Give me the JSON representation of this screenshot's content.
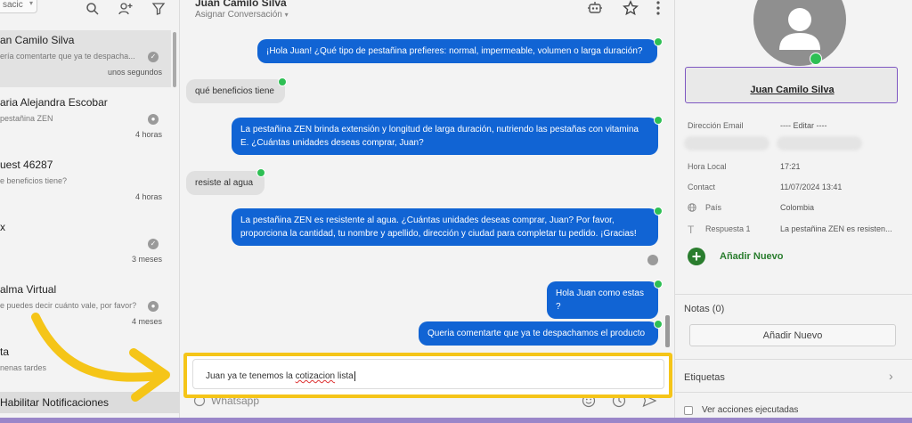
{
  "left_panel": {
    "filter_value": "sacic",
    "conversations": [
      {
        "name": "an Camilo Silva",
        "snippet": "ería comentarte que ya te despacha...",
        "time": "unos segundos",
        "active": true
      },
      {
        "name": "aria Alejandra Escobar",
        "snippet": "pestañina ZEN",
        "time": "4 horas",
        "active": false
      },
      {
        "name": "uest 46287",
        "snippet": "e beneficios tiene?",
        "time": "4 horas",
        "active": false
      },
      {
        "name": "x",
        "snippet": "",
        "time": "3 meses",
        "active": false
      },
      {
        "name": "alma Virtual",
        "snippet": "e puedes decir cuánto vale, por favor?",
        "time": "4 meses",
        "active": false
      },
      {
        "name": "ta",
        "snippet": "nenas tardes",
        "time": "",
        "active": false
      }
    ],
    "notifications_label": "Habilitar Notificaciones"
  },
  "chat": {
    "contact_name": "Juan Camilo Silva",
    "assign_label": "Asignar Conversación",
    "messages": [
      {
        "dir": "out",
        "text": "¡Hola Juan! ¿Qué tipo de pestañina prefieres: normal, impermeable, volumen o larga duración?"
      },
      {
        "dir": "in",
        "text": "qué beneficios tiene"
      },
      {
        "dir": "out",
        "text": "La pestañina ZEN brinda extensión y longitud de larga duración, nutriendo las pestañas con vitamina E. ¿Cuántas unidades deseas comprar, Juan?"
      },
      {
        "dir": "in",
        "text": "resiste al agua"
      },
      {
        "dir": "out",
        "text": "La pestañina ZEN es resistente al agua. ¿Cuántas unidades deseas comprar, Juan? Por favor, proporciona la cantidad, tu nombre y apellido, dirección y ciudad para completar tu pedido. ¡Gracias!"
      },
      {
        "dir": "out",
        "text": "Hola Juan como estas ?"
      },
      {
        "dir": "out",
        "text": "Queria comentarte que ya te despachamos el producto"
      }
    ],
    "composer_text_a": "Juan ya te tenemos la ",
    "composer_text_b": "cotizacion",
    "composer_text_c": " lista",
    "channel_label": "Whatsapp"
  },
  "profile": {
    "name": "Juan Camilo Silva",
    "fields": [
      {
        "label": "Dirección Email",
        "value": "---- Editar ----"
      },
      {
        "label": "Hora Local",
        "value": "17:21"
      },
      {
        "label": "Contact",
        "value": "11/07/2024 13:41"
      },
      {
        "label": "País",
        "value": "Colombia"
      },
      {
        "label": "Respuesta 1",
        "value": "La pestañina ZEN es resisten..."
      }
    ],
    "add_new_label": "Añadir Nuevo",
    "notes_title": "Notas (0)",
    "notes_button": "Añadir Nuevo",
    "tags_title": "Etiquetas",
    "actions_label": "Ver acciones ejecutadas"
  },
  "colors": {
    "accent_blue": "#1164d4",
    "whatsapp_green": "#2ebf54",
    "highlight_yellow": "#f5c518",
    "name_border_purple": "#7e57c2",
    "add_green": "#2a7d2e"
  },
  "icons": [
    "search-icon",
    "add-contact-icon",
    "filter-icon",
    "robot-icon",
    "star-icon",
    "more-vertical-icon",
    "whatsapp-icon",
    "person-icon",
    "emoji-icon",
    "send-icon",
    "clock-icon",
    "chevron-right-icon",
    "globe-icon",
    "text-icon"
  ]
}
